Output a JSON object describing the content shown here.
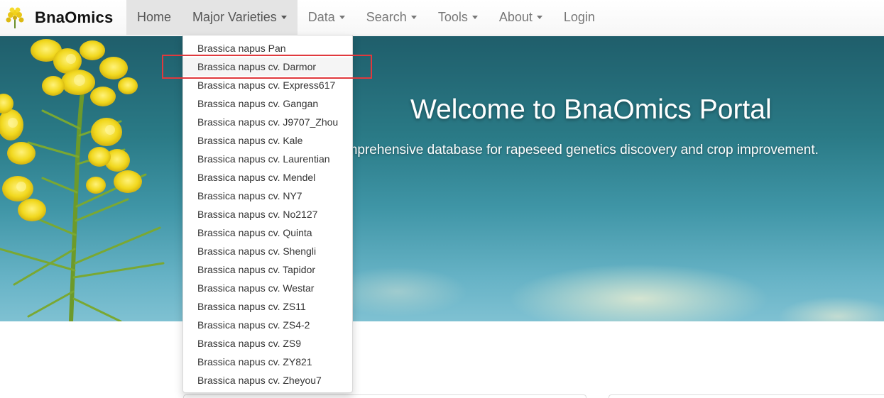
{
  "navbar": {
    "brand": "BnaOmics",
    "brand_logo_icon": "rapeseed-flower-logo-icon",
    "items": [
      {
        "label": "Home",
        "has_caret": false
      },
      {
        "label": "Major Varieties",
        "has_caret": true
      },
      {
        "label": "Data",
        "has_caret": true
      },
      {
        "label": "Search",
        "has_caret": true
      },
      {
        "label": "Tools",
        "has_caret": true
      },
      {
        "label": "About",
        "has_caret": true
      },
      {
        "label": "Login",
        "has_caret": false
      }
    ]
  },
  "dropdown": {
    "open_menu": "Major Varieties",
    "highlighted_item": "Brassica napus cv. Darmor",
    "items": [
      "Brassica napus Pan",
      "Brassica napus cv. Darmor",
      "Brassica napus cv. Express617",
      "Brassica napus cv. Gangan",
      "Brassica napus cv. J9707_Zhou",
      "Brassica napus cv. Kale",
      "Brassica napus cv. Laurentian",
      "Brassica napus cv. Mendel",
      "Brassica napus cv. NY7",
      "Brassica napus cv. No2127",
      "Brassica napus cv. Quinta",
      "Brassica napus cv. Shengli",
      "Brassica napus cv. Tapidor",
      "Brassica napus cv. Westar",
      "Brassica napus cv. ZS11",
      "Brassica napus cv. ZS4-2",
      "Brassica napus cv. ZS9",
      "Brassica napus cv. ZY821",
      "Brassica napus cv. Zheyou7"
    ]
  },
  "hero": {
    "title": "Welcome to BnaOmics Portal",
    "subtitle": "omprehensive database for rapeseed genetics discovery and crop improvement.",
    "background_image": "rapeseed-flower-sky-photo"
  },
  "colors": {
    "highlight_border": "#e0393d",
    "nav_active_bg": "#e4e4e4",
    "nav_text": "#777777"
  }
}
